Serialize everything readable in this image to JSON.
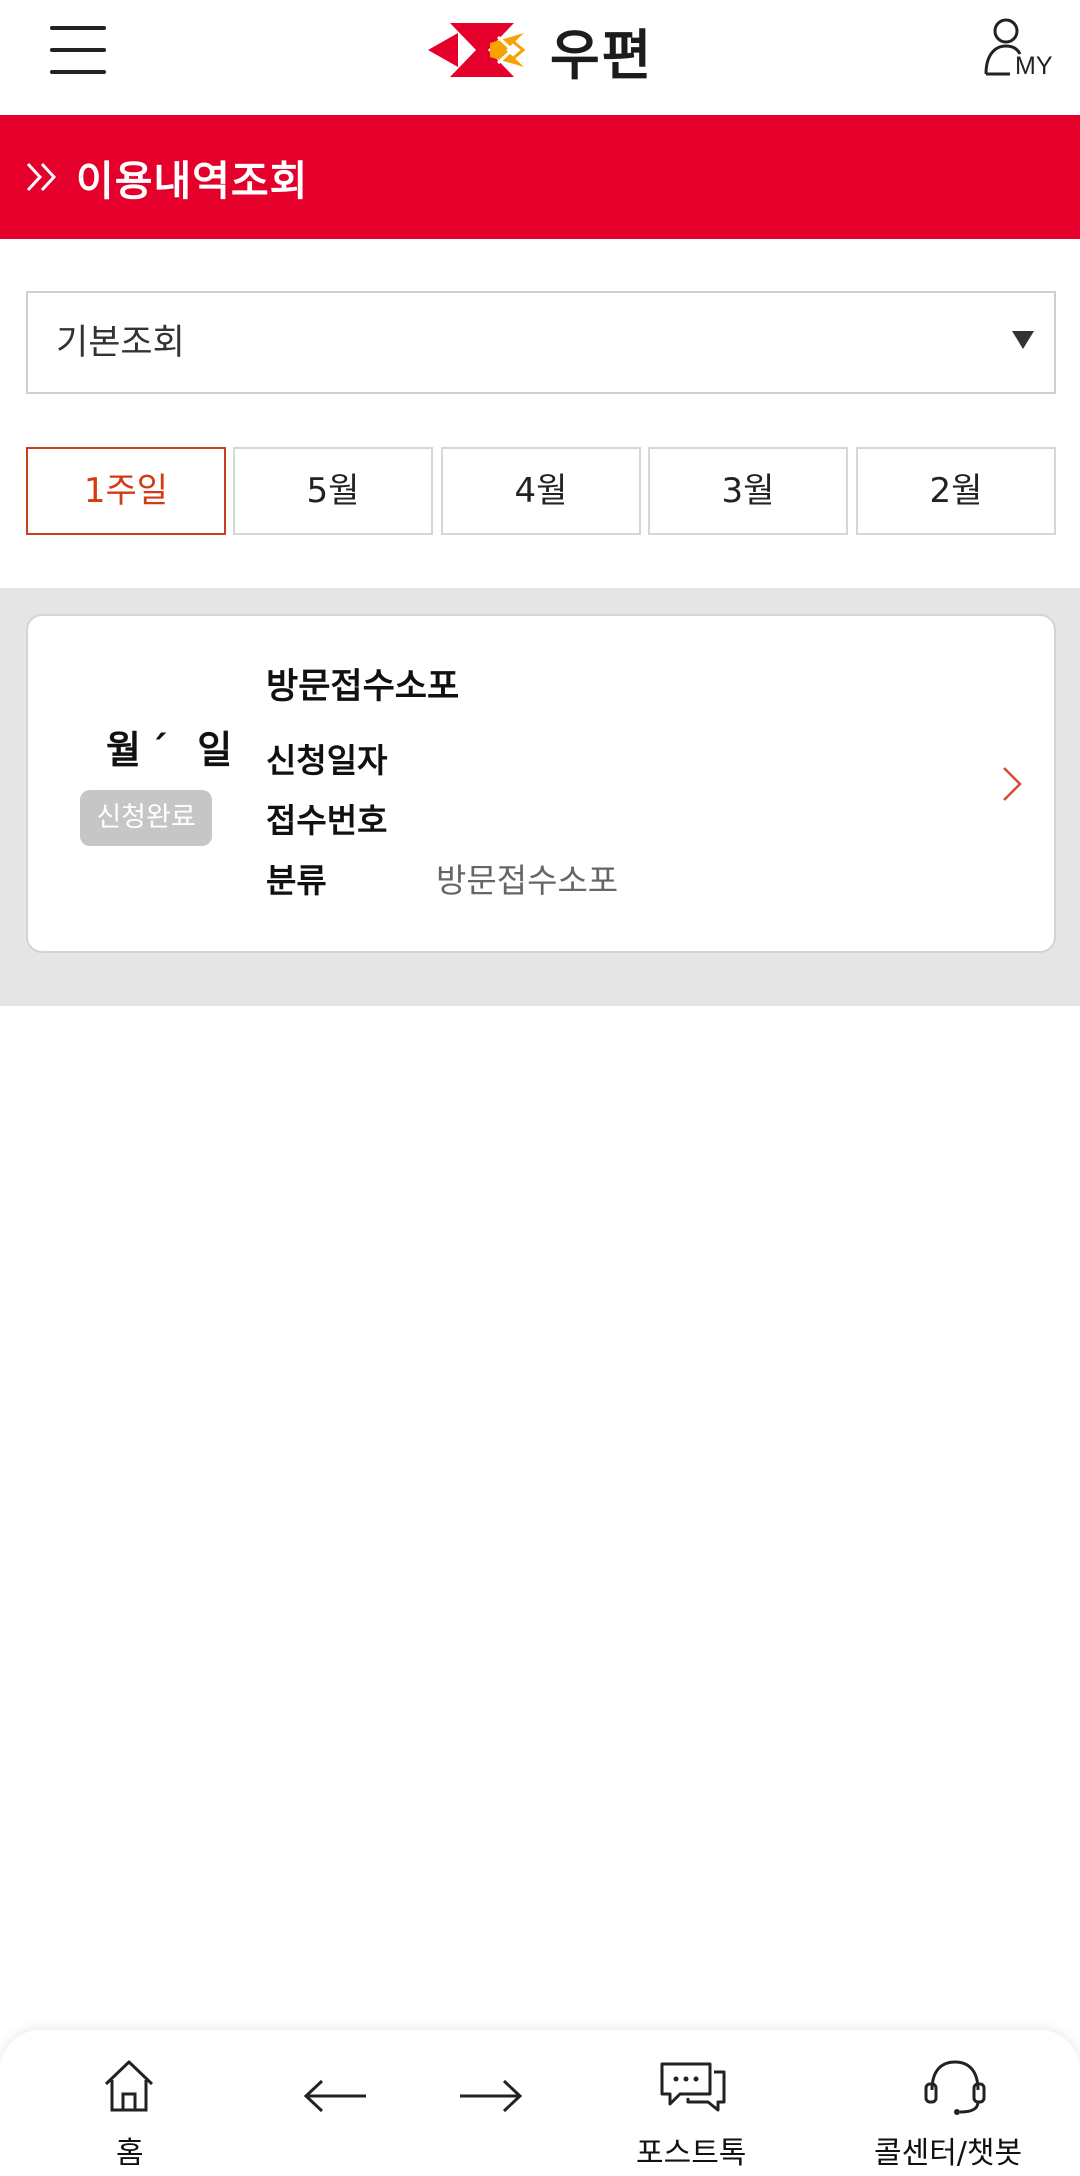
{
  "header": {
    "logo_text": "우편",
    "my_label": "MY"
  },
  "page": {
    "title": "이용내역조회"
  },
  "search": {
    "selected_option": "기본조회"
  },
  "period_tabs": [
    {
      "label": "1주일",
      "active": true
    },
    {
      "label": "5월",
      "active": false
    },
    {
      "label": "4월",
      "active": false
    },
    {
      "label": "3월",
      "active": false
    },
    {
      "label": "2월",
      "active": false
    }
  ],
  "results": [
    {
      "date": "월´ 일",
      "status": "신청완료",
      "title": "방문접수소포",
      "fields": [
        {
          "label": "신청일자",
          "value": ""
        },
        {
          "label": "접수번호",
          "value": ""
        },
        {
          "label": "분류",
          "value": "방문접수소포"
        }
      ]
    }
  ],
  "bottom_nav": {
    "home": "홈",
    "back": "",
    "forward": "",
    "posttalk": "포스트톡",
    "callcenter": "콜센터/챗봇"
  },
  "colors": {
    "brand_red": "#e4002b",
    "active_tab": "#d43b14",
    "badge_gray": "#c6c6c6"
  }
}
